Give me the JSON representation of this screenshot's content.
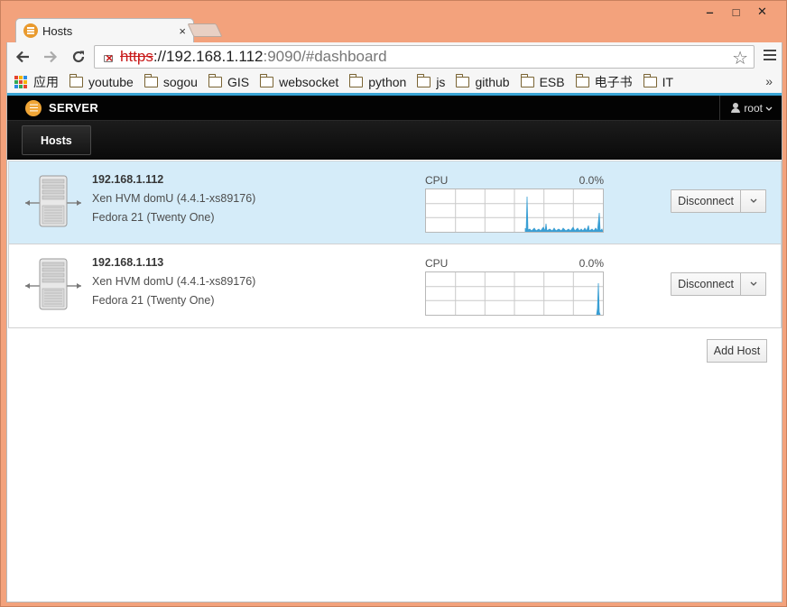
{
  "browser": {
    "tab_title": "Hosts",
    "tab_close": "×",
    "url": {
      "scheme": "https",
      "host": "://192.168.1.112",
      "rest": ":9090/#dashboard"
    },
    "window_controls": [
      "‒",
      "□",
      "✕"
    ]
  },
  "bookmarks": {
    "apps_label": "应用",
    "items": [
      "youtube",
      "sogou",
      "GIS",
      "websocket",
      "python",
      "js",
      "github",
      "ESB",
      "电子书",
      "IT"
    ],
    "more": "»"
  },
  "navbar": {
    "brand": "SERVER",
    "user": "root",
    "user_caret": "⌄",
    "active_tab": "Hosts"
  },
  "hosts": [
    {
      "address": "192.168.1.112",
      "platform": "Xen HVM domU (4.4.1-xs89176)",
      "os": "Fedora 21 (Twenty One)",
      "cpu_label": "CPU",
      "cpu_value": "0.0%",
      "selected": true,
      "disconnect_label": "Disconnect"
    },
    {
      "address": "192.168.1.113",
      "platform": "Xen HVM domU (4.4.1-xs89176)",
      "os": "Fedora 21 (Twenty One)",
      "cpu_label": "CPU",
      "cpu_value": "0.0%",
      "selected": false,
      "disconnect_label": "Disconnect"
    }
  ],
  "add_host_label": "Add Host",
  "colors": {
    "window_frame": "#f3a27c",
    "brand_accent": "#f0a536",
    "topline": "#3aa5d6",
    "selected_row": "#d5ecf9",
    "cpu_trace": "#3a9fd4"
  }
}
